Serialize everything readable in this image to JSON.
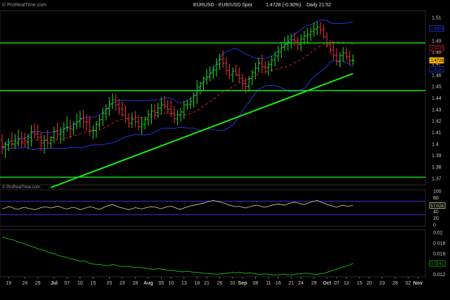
{
  "header": {
    "brand": "© ProRealTime.com",
    "title_symbol": "EURUSD - EUR/USD Spot",
    "title_quote": "1.4728 (-0.30%)",
    "title_period": "Daily 21:52",
    "watermark": "© ProRealTime.com"
  },
  "colors": {
    "background": "#000000",
    "bull_bar": "#1fd11f",
    "bear_bar": "#e0303a",
    "band": "#2636d6",
    "trendline": "#18e818",
    "horizontal_lines": "#18e818",
    "ma": "#c2262c",
    "oscillator_line": "#d8d8a0",
    "oscillator_bands": "#2a2aaa",
    "lower_line": "#1aa81a",
    "axis_text": "#c8c8c8"
  },
  "chart_data": [
    {
      "type": "candlestick",
      "panel": "price",
      "ylim": [
        1.365,
        1.515
      ],
      "yticks": [
        "1.51",
        "1.5",
        "1.49",
        "1.48",
        "1.47",
        "1.46",
        "1.45",
        "1.44",
        "1.43",
        "1.42",
        "1.41",
        "1.4",
        "1.39",
        "1.38",
        "1.37"
      ],
      "y_tick_values": [
        1.51,
        1.5,
        1.49,
        1.48,
        1.47,
        1.46,
        1.45,
        1.44,
        1.43,
        1.42,
        1.41,
        1.4,
        1.39,
        1.38,
        1.37
      ],
      "bars_count": 109,
      "ohlc": [
        [
          1.4034,
          1.4084,
          1.3911,
          1.3967
        ],
        [
          1.3972,
          1.4018,
          1.3877,
          1.3998
        ],
        [
          1.3994,
          1.4048,
          1.3937,
          1.4004
        ],
        [
          1.4023,
          1.4102,
          1.3967,
          1.4003
        ],
        [
          1.3999,
          1.4084,
          1.3957,
          1.4022
        ],
        [
          1.4015,
          1.4125,
          1.3975,
          1.4036
        ],
        [
          1.4048,
          1.4107,
          1.3969,
          1.4018
        ],
        [
          1.4044,
          1.4096,
          1.3972,
          1.4031
        ],
        [
          1.4022,
          1.4087,
          1.3958,
          1.4061
        ],
        [
          1.4058,
          1.4164,
          1.3977,
          1.4103
        ],
        [
          1.4105,
          1.4178,
          1.4047,
          1.4087
        ],
        [
          1.4087,
          1.4169,
          1.4035,
          1.4056
        ],
        [
          1.4061,
          1.4099,
          1.3939,
          1.4006
        ],
        [
          1.401,
          1.4078,
          1.3917,
          1.4031
        ],
        [
          1.4036,
          1.4119,
          1.3959,
          1.4011
        ],
        [
          1.4004,
          1.4068,
          1.3963,
          1.4056
        ],
        [
          1.4056,
          1.415,
          1.4006,
          1.4106
        ],
        [
          1.4108,
          1.4186,
          1.4034,
          1.408
        ],
        [
          1.4085,
          1.4146,
          1.4003,
          1.4105
        ],
        [
          1.4106,
          1.4187,
          1.4026,
          1.4132
        ],
        [
          1.4142,
          1.424,
          1.4106,
          1.4144
        ],
        [
          1.4136,
          1.4213,
          1.4049,
          1.4131
        ],
        [
          1.4127,
          1.4198,
          1.4076,
          1.4171
        ],
        [
          1.4171,
          1.4263,
          1.4127,
          1.4194
        ],
        [
          1.4193,
          1.429,
          1.4142,
          1.4222
        ],
        [
          1.4223,
          1.4296,
          1.4136,
          1.4192
        ],
        [
          1.4193,
          1.4257,
          1.4114,
          1.4188
        ],
        [
          1.4196,
          1.4244,
          1.4069,
          1.4113
        ],
        [
          1.4113,
          1.4162,
          1.4043,
          1.412
        ],
        [
          1.4118,
          1.4201,
          1.4054,
          1.4171
        ],
        [
          1.417,
          1.4252,
          1.4128,
          1.421
        ],
        [
          1.4216,
          1.4315,
          1.4156,
          1.4268
        ],
        [
          1.4266,
          1.4345,
          1.4203,
          1.4306
        ],
        [
          1.4308,
          1.4406,
          1.4246,
          1.4347
        ],
        [
          1.435,
          1.444,
          1.4302,
          1.4385
        ],
        [
          1.4383,
          1.4436,
          1.429,
          1.4342
        ],
        [
          1.4346,
          1.4389,
          1.4255,
          1.4302
        ],
        [
          1.4304,
          1.4374,
          1.4235,
          1.4255
        ],
        [
          1.4253,
          1.4337,
          1.4188,
          1.4221
        ],
        [
          1.4217,
          1.4267,
          1.4139,
          1.418
        ],
        [
          1.418,
          1.4274,
          1.4141,
          1.4214
        ],
        [
          1.4219,
          1.4287,
          1.4149,
          1.419
        ],
        [
          1.4191,
          1.4249,
          1.4117,
          1.4148
        ],
        [
          1.4149,
          1.4236,
          1.4082,
          1.4172
        ],
        [
          1.4173,
          1.4239,
          1.4127,
          1.4215
        ],
        [
          1.4211,
          1.4297,
          1.4158,
          1.4257
        ],
        [
          1.4254,
          1.435,
          1.4172,
          1.4288
        ],
        [
          1.4286,
          1.4345,
          1.4216,
          1.4271
        ],
        [
          1.4274,
          1.4358,
          1.4226,
          1.4314
        ],
        [
          1.431,
          1.4408,
          1.4262,
          1.4339
        ],
        [
          1.4342,
          1.4421,
          1.4302,
          1.4327
        ],
        [
          1.4329,
          1.4382,
          1.4263,
          1.4302
        ],
        [
          1.4305,
          1.4382,
          1.4234,
          1.4263
        ],
        [
          1.4269,
          1.4332,
          1.4179,
          1.4219
        ],
        [
          1.4218,
          1.4295,
          1.4162,
          1.4253
        ],
        [
          1.425,
          1.4311,
          1.4196,
          1.4279
        ],
        [
          1.4278,
          1.4377,
          1.4217,
          1.434
        ],
        [
          1.4339,
          1.4385,
          1.4297,
          1.4347
        ],
        [
          1.4345,
          1.4408,
          1.4304,
          1.437
        ],
        [
          1.4369,
          1.4446,
          1.4315,
          1.442
        ],
        [
          1.4424,
          1.4557,
          1.4349,
          1.4497
        ],
        [
          1.4494,
          1.4542,
          1.4433,
          1.4529
        ],
        [
          1.453,
          1.4589,
          1.4469,
          1.4571
        ],
        [
          1.4565,
          1.4653,
          1.4516,
          1.4581
        ],
        [
          1.458,
          1.4677,
          1.4545,
          1.4617
        ],
        [
          1.4617,
          1.4686,
          1.4565,
          1.4647
        ],
        [
          1.4645,
          1.4747,
          1.4585,
          1.4694
        ],
        [
          1.4696,
          1.4789,
          1.4641,
          1.4737
        ],
        [
          1.4739,
          1.4815,
          1.4662,
          1.4702
        ],
        [
          1.4703,
          1.4755,
          1.4604,
          1.4639
        ],
        [
          1.4639,
          1.4697,
          1.4562,
          1.4601
        ],
        [
          1.4601,
          1.4666,
          1.4537,
          1.4635
        ],
        [
          1.4635,
          1.469,
          1.4588,
          1.4603
        ],
        [
          1.4599,
          1.4664,
          1.4536,
          1.457
        ],
        [
          1.457,
          1.4613,
          1.4475,
          1.4523
        ],
        [
          1.4528,
          1.4577,
          1.4442,
          1.4498
        ],
        [
          1.45,
          1.459,
          1.4457,
          1.457
        ],
        [
          1.457,
          1.4644,
          1.4511,
          1.4623
        ],
        [
          1.4623,
          1.471,
          1.4562,
          1.4661
        ],
        [
          1.4658,
          1.4753,
          1.4621,
          1.4704
        ],
        [
          1.4702,
          1.4776,
          1.4627,
          1.4672
        ],
        [
          1.4671,
          1.4721,
          1.4613,
          1.4668
        ],
        [
          1.4668,
          1.4723,
          1.4595,
          1.4695
        ],
        [
          1.4691,
          1.4768,
          1.4631,
          1.4729
        ],
        [
          1.4734,
          1.4806,
          1.4678,
          1.477
        ],
        [
          1.4765,
          1.4855,
          1.4717,
          1.4801
        ],
        [
          1.4801,
          1.4889,
          1.4752,
          1.4842
        ],
        [
          1.4842,
          1.4933,
          1.4808,
          1.4866
        ],
        [
          1.4869,
          1.495,
          1.4812,
          1.4888
        ],
        [
          1.4886,
          1.4963,
          1.483,
          1.4906
        ],
        [
          1.4908,
          1.4969,
          1.4855,
          1.4898
        ],
        [
          1.4895,
          1.4935,
          1.4814,
          1.4867
        ],
        [
          1.4866,
          1.4953,
          1.4807,
          1.4913
        ],
        [
          1.4915,
          1.4987,
          1.4868,
          1.4941
        ],
        [
          1.4939,
          1.501,
          1.4875,
          1.4951
        ],
        [
          1.4954,
          1.5015,
          1.4897,
          1.498
        ],
        [
          1.498,
          1.5056,
          1.4935,
          1.5002
        ],
        [
          1.5001,
          1.5066,
          1.4948,
          1.5016
        ],
        [
          1.5015,
          1.5061,
          1.4955,
          1.4995
        ],
        [
          1.4995,
          1.504,
          1.4915,
          1.4933
        ],
        [
          1.493,
          1.4974,
          1.4839,
          1.4868
        ],
        [
          1.4866,
          1.4907,
          1.4786,
          1.4816
        ],
        [
          1.4815,
          1.4876,
          1.4734,
          1.4774
        ],
        [
          1.4773,
          1.483,
          1.4683,
          1.4718
        ],
        [
          1.4716,
          1.4797,
          1.4667,
          1.4768
        ],
        [
          1.4771,
          1.4843,
          1.4716,
          1.4792
        ],
        [
          1.4791,
          1.4841,
          1.473,
          1.476
        ],
        [
          1.476,
          1.4812,
          1.4688,
          1.4728
        ],
        [
          1.4728,
          1.4778,
          1.4687,
          1.4728
        ]
      ],
      "horizontal_levels": [
        1.488,
        1.4465,
        1.371
      ],
      "trendline": {
        "start": [
          15,
          1.362
        ],
        "end": [
          108,
          1.4613
        ]
      },
      "price_tags": [
        {
          "value": "1.5005",
          "price": 1.5005,
          "color": "#2636d6"
        },
        {
          "value": "1.4835",
          "price": 1.4835,
          "color": "#c2262c"
        },
        {
          "value": "1.4728",
          "price": 1.4728,
          "color": "#f0b000"
        },
        {
          "value": "1.465",
          "price": 1.465,
          "color": "#2636d6"
        }
      ]
    },
    {
      "type": "line",
      "panel": "oscillator",
      "ylim": [
        0,
        100
      ],
      "yticks": [
        "100",
        "80",
        "60",
        "40",
        "20",
        "0"
      ],
      "y_tick_values": [
        100,
        80,
        60,
        40,
        20,
        0
      ],
      "bands": [
        70,
        30
      ],
      "values": [
        48,
        50,
        54,
        52,
        47,
        46,
        50,
        52,
        49,
        47,
        45,
        48,
        51,
        53,
        52,
        50,
        52,
        55,
        53,
        49,
        47,
        50,
        52,
        49,
        45,
        47,
        51,
        53,
        52,
        48,
        46,
        50,
        55,
        58,
        60,
        56,
        52,
        50,
        47,
        45,
        48,
        51,
        49,
        47,
        50,
        52,
        54,
        53,
        50,
        48,
        51,
        54,
        55,
        52,
        48,
        46,
        50,
        53,
        56,
        58,
        60,
        62,
        64,
        67,
        70,
        72,
        70,
        68,
        65,
        62,
        58,
        56,
        54,
        55,
        52,
        50,
        53,
        56,
        58,
        57,
        54,
        52,
        55,
        58,
        60,
        62,
        60,
        58,
        62,
        65,
        67,
        65,
        62,
        60,
        64,
        67,
        70,
        72,
        68,
        65,
        60,
        58,
        55,
        52,
        56,
        58,
        55,
        56,
        57
      ],
      "last_value": "57.028"
    },
    {
      "type": "line",
      "panel": "lower",
      "ylim": [
        0.0118,
        0.0203
      ],
      "yticks": [
        "0.02",
        "0.018",
        "0.016",
        "0.014",
        "0.012"
      ],
      "y_tick_values": [
        0.02,
        0.018,
        0.016,
        0.014,
        0.012
      ],
      "values": [
        0.0192,
        0.019,
        0.0188,
        0.0187,
        0.0185,
        0.0182,
        0.0181,
        0.0178,
        0.0176,
        0.0174,
        0.0172,
        0.0169,
        0.0168,
        0.0166,
        0.0163,
        0.0161,
        0.016,
        0.0157,
        0.0155,
        0.0154,
        0.0152,
        0.015,
        0.0149,
        0.0147,
        0.0145,
        0.0146,
        0.0144,
        0.0141,
        0.014,
        0.0139,
        0.0139,
        0.0138,
        0.0137,
        0.0137,
        0.0139,
        0.0138,
        0.0136,
        0.0135,
        0.0135,
        0.0136,
        0.0134,
        0.0133,
        0.0134,
        0.0133,
        0.0132,
        0.0131,
        0.013,
        0.013,
        0.0131,
        0.013,
        0.0129,
        0.0128,
        0.0128,
        0.0127,
        0.0126,
        0.0125,
        0.0125,
        0.0126,
        0.0125,
        0.0124,
        0.0124,
        0.0123,
        0.0122,
        0.0122,
        0.0121,
        0.0121,
        0.012,
        0.0121,
        0.0121,
        0.0122,
        0.0123,
        0.0124,
        0.0123,
        0.0124,
        0.0123,
        0.0122,
        0.0123,
        0.0122,
        0.0121,
        0.012,
        0.012,
        0.0121,
        0.012,
        0.0119,
        0.0119,
        0.0119,
        0.012,
        0.012,
        0.0119,
        0.0119,
        0.012,
        0.0121,
        0.0121,
        0.0122,
        0.0122,
        0.0121,
        0.012,
        0.012,
        0.0121,
        0.0122,
        0.0124,
        0.0126,
        0.0128,
        0.013,
        0.0132,
        0.0134,
        0.0136,
        0.0138,
        0.0141
      ],
      "last_value": "0.0141"
    }
  ],
  "x_axis": {
    "labels": [
      {
        "text": "19",
        "bar": 2,
        "bold": false
      },
      {
        "text": "24",
        "bar": 7,
        "bold": false
      },
      {
        "text": "29",
        "bar": 11,
        "bold": false
      },
      {
        "text": "Jul",
        "bar": 16,
        "bold": true
      },
      {
        "text": "07",
        "bar": 20,
        "bold": false
      },
      {
        "text": "10",
        "bar": 24,
        "bold": false
      },
      {
        "text": "15",
        "bar": 28,
        "bold": false
      },
      {
        "text": "20",
        "bar": 33,
        "bold": false
      },
      {
        "text": "23",
        "bar": 37,
        "bold": false
      },
      {
        "text": "28",
        "bar": 41,
        "bold": false
      },
      {
        "text": "Aug",
        "bar": 45,
        "bold": true
      },
      {
        "text": "05",
        "bar": 49,
        "bold": false
      },
      {
        "text": "10",
        "bar": 52,
        "bold": false
      },
      {
        "text": "13",
        "bar": 56,
        "bold": false
      },
      {
        "text": "18",
        "bar": 60,
        "bold": false
      },
      {
        "text": "21",
        "bar": 63,
        "bold": false
      },
      {
        "text": "26",
        "bar": 67,
        "bold": false
      },
      {
        "text": "31",
        "bar": 71,
        "bold": false
      },
      {
        "text": "Sep",
        "bar": 74,
        "bold": true
      },
      {
        "text": "08",
        "bar": 78,
        "bold": false
      },
      {
        "text": "11",
        "bar": 82,
        "bold": false
      },
      {
        "text": "16",
        "bar": 85,
        "bold": false
      },
      {
        "text": "21",
        "bar": 89,
        "bold": false
      },
      {
        "text": "24",
        "bar": 92,
        "bold": false
      },
      {
        "text": "29",
        "bar": 96,
        "bold": false
      },
      {
        "text": "Oct",
        "bar": 100,
        "bold": true
      },
      {
        "text": "07",
        "bar": 103,
        "bold": false
      },
      {
        "text": "12",
        "bar": 106,
        "bold": false
      },
      {
        "text": "15",
        "bar": 110,
        "bold": false
      },
      {
        "text": "20",
        "bar": 113,
        "bold": false
      },
      {
        "text": "23",
        "bar": 117,
        "bold": false
      },
      {
        "text": "28",
        "bar": 121,
        "bold": false
      },
      {
        "text": "02",
        "bar": 125,
        "bold": false
      },
      {
        "text": "Nov",
        "bar": 128,
        "bold": true
      }
    ]
  }
}
